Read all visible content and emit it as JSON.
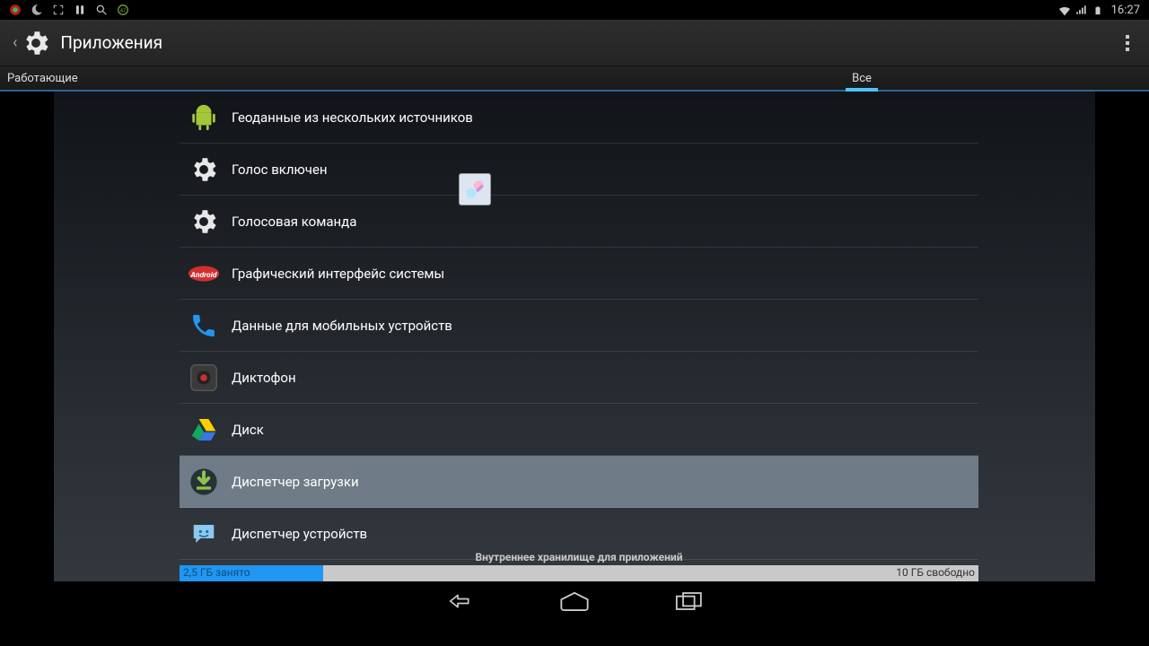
{
  "status": {
    "time": "16:27"
  },
  "header": {
    "title": "Приложения"
  },
  "tabs": {
    "running": "Работающие",
    "all": "Все"
  },
  "apps": [
    {
      "label": "Геоданные из нескольких источников",
      "icon": "android"
    },
    {
      "label": "Голос включен",
      "icon": "gear"
    },
    {
      "label": "Голосовая команда",
      "icon": "gear"
    },
    {
      "label": "Графический интерфейс системы",
      "icon": "kitkat"
    },
    {
      "label": "Данные для мобильных устройств",
      "icon": "phone"
    },
    {
      "label": "Диктофон",
      "icon": "recorder"
    },
    {
      "label": "Диск",
      "icon": "drive"
    },
    {
      "label": "Диспетчер загрузки",
      "icon": "download",
      "selected": true
    },
    {
      "label": "Диспетчер устройств",
      "icon": "chat"
    }
  ],
  "storage": {
    "title": "Внутреннее хранилище для приложений",
    "used_label": "2,5 ГБ занято",
    "free_label": "10 ГБ свободно",
    "used_pct": 18
  }
}
